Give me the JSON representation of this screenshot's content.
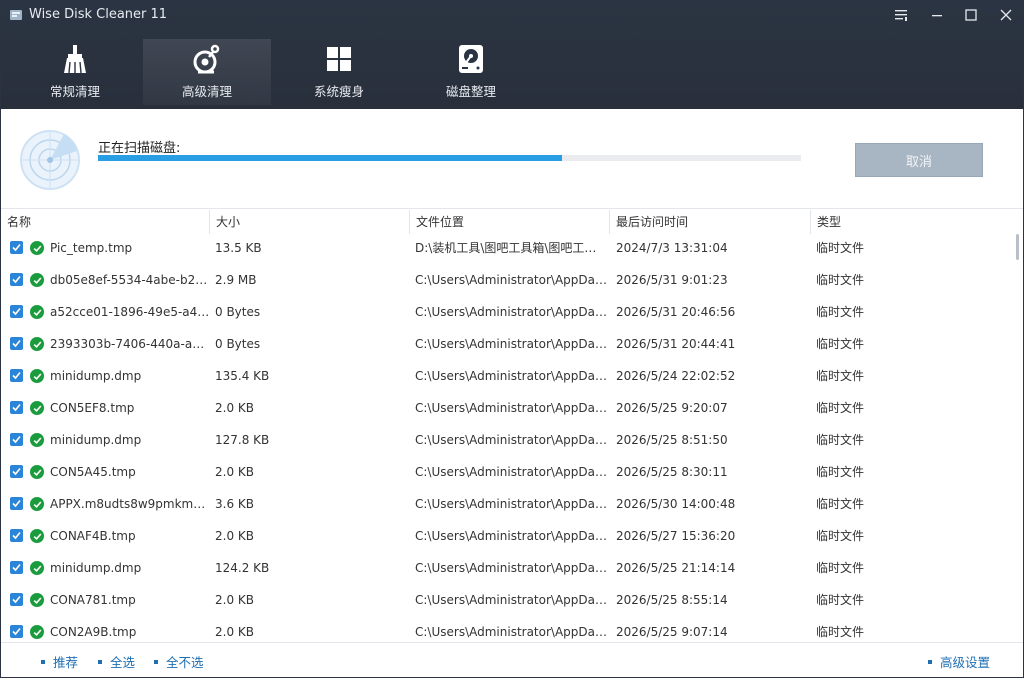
{
  "window": {
    "title": "Wise Disk Cleaner 11"
  },
  "tabs": [
    {
      "label": "常规清理",
      "icon": "broom-icon"
    },
    {
      "label": "高级清理",
      "icon": "advanced-clean-icon"
    },
    {
      "label": "系统瘦身",
      "icon": "windows-slim-icon"
    },
    {
      "label": "磁盘整理",
      "icon": "disk-defrag-icon"
    }
  ],
  "active_tab": "高级清理",
  "scan": {
    "label": "正在扫描磁盘:",
    "progress": 0.66,
    "cancel_label": "取消"
  },
  "table": {
    "columns": [
      "名称",
      "大小",
      "文件位置",
      "最后访问时间",
      "类型"
    ],
    "rows": [
      {
        "name": "Pic_temp.tmp",
        "size": "13.5 KB",
        "location": "D:\\装机工具\\图吧工具箱\\图吧工具...",
        "time": "2024/7/3 13:31:04",
        "type": "临时文件"
      },
      {
        "name": "db05e8ef-5534-4abe-b2d...",
        "size": "2.9 MB",
        "location": "C:\\Users\\Administrator\\AppDat...",
        "time": "2026/5/31 9:01:23",
        "type": "临时文件"
      },
      {
        "name": "a52cce01-1896-49e5-a4af...",
        "size": "0 Bytes",
        "location": "C:\\Users\\Administrator\\AppDat...",
        "time": "2026/5/31 20:46:56",
        "type": "临时文件"
      },
      {
        "name": "2393303b-7406-440a-a44...",
        "size": "0 Bytes",
        "location": "C:\\Users\\Administrator\\AppDat...",
        "time": "2026/5/31 20:44:41",
        "type": "临时文件"
      },
      {
        "name": "minidump.dmp",
        "size": "135.4 KB",
        "location": "C:\\Users\\Administrator\\AppDat...",
        "time": "2026/5/24 22:02:52",
        "type": "临时文件"
      },
      {
        "name": "CON5EF8.tmp",
        "size": "2.0 KB",
        "location": "C:\\Users\\Administrator\\AppDat...",
        "time": "2026/5/25 9:20:07",
        "type": "临时文件"
      },
      {
        "name": "minidump.dmp",
        "size": "127.8 KB",
        "location": "C:\\Users\\Administrator\\AppDat...",
        "time": "2026/5/25 8:51:50",
        "type": "临时文件"
      },
      {
        "name": "CON5A45.tmp",
        "size": "2.0 KB",
        "location": "C:\\Users\\Administrator\\AppDat...",
        "time": "2026/5/25 8:30:11",
        "type": "临时文件"
      },
      {
        "name": "APPX.m8udts8w9pmkmm...",
        "size": "3.6 KB",
        "location": "C:\\Users\\Administrator\\AppDat...",
        "time": "2026/5/30 14:00:48",
        "type": "临时文件"
      },
      {
        "name": "CONAF4B.tmp",
        "size": "2.0 KB",
        "location": "C:\\Users\\Administrator\\AppDat...",
        "time": "2026/5/27 15:36:20",
        "type": "临时文件"
      },
      {
        "name": "minidump.dmp",
        "size": "124.2 KB",
        "location": "C:\\Users\\Administrator\\AppDat...",
        "time": "2026/5/25 21:14:14",
        "type": "临时文件"
      },
      {
        "name": "CONA781.tmp",
        "size": "2.0 KB",
        "location": "C:\\Users\\Administrator\\AppDat...",
        "time": "2026/5/25 8:55:14",
        "type": "临时文件"
      },
      {
        "name": "CON2A9B.tmp",
        "size": "2.0 KB",
        "location": "C:\\Users\\Administrator\\AppDat...",
        "time": "2026/5/25 9:07:14",
        "type": "临时文件"
      }
    ]
  },
  "footer": {
    "recommend": "推荐",
    "select_all": "全选",
    "select_none": "全不选",
    "advanced_settings": "高级设置"
  },
  "colors": {
    "header_bg": "#2a313d",
    "accent": "#2a9ee4",
    "check_blue": "#2a85d8",
    "ok_green": "#1a9c3e",
    "link": "#1f6fb3"
  }
}
